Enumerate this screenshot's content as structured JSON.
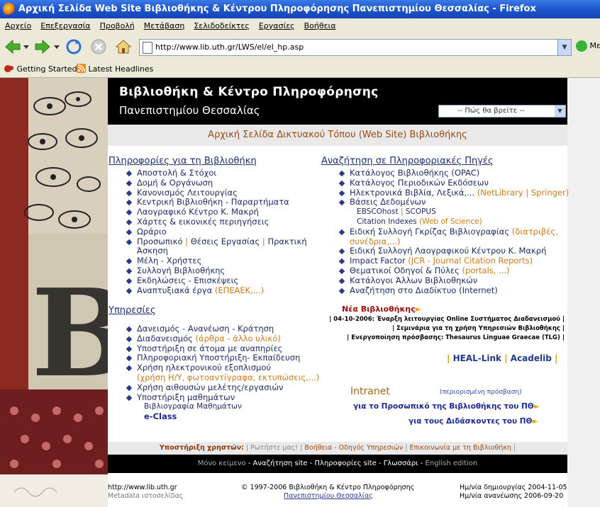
{
  "window": {
    "title": "Αρχική Σελίδα Web Site Βιβλιοθήκης & Κέντρου Πληροφόρησης Πανεπιστημίου Θεσσαλίας - Firefox"
  },
  "menu": [
    "Αρχείο",
    "Επεξεργασία",
    "Προβολή",
    "Μετάβαση",
    "Σελιδοδείκτες",
    "Εργασίες",
    "Βοήθεια"
  ],
  "address": {
    "url": "http://www.lib.uth.gr/LWS/el/el_hp.asp",
    "go_label": "Με"
  },
  "bookmarks": {
    "getting_started": "Getting Started",
    "latest_headlines": "Latest Headlines"
  },
  "header": {
    "title": "Βιβλιοθήκη & Κέντρο Πληροφόρησης",
    "subtitle": "Πανεπιστημίου Θεσσαλίας",
    "select_placeholder": "-- Πώς θα βρείτε --",
    "page_subtitle": "Αρχική Σελίδα Δικτυακού Τόπου (Web Site) Βιβλιοθήκης"
  },
  "left": {
    "info_heading": "Πληροφορίες για τη Βιβλιοθήκη",
    "info_items": [
      "Αποστολή & Στόχοι",
      "Δομή & Οργάνωση",
      "Κανονισμός Λειτουργίας",
      "Κεντρική Βιβλιοθήκη - Παραρτήματα",
      "Λαογραφικό Κέντρο Κ. Μακρή",
      "Χάρτες & εικονικές περιηγήσεις",
      "Ωράριο"
    ],
    "staff": {
      "a": "Προσωπικό",
      "sep1": "|",
      "b": "Θέσεις Εργασίας",
      "sep2": "|",
      "c": "Πρακτική",
      "d": "Άσκηση"
    },
    "info_items2": [
      "Μέλη - Χρήστες",
      "Συλλογή Βιβλιοθήκης",
      "Εκδηλώσεις - Επισκέψεις"
    ],
    "dev": {
      "a": "Αναπτυξιακά έργα",
      "b": "(ΕΠΕΑΕΚ,...)"
    },
    "services_heading": "Υπηρεσίες",
    "services": [
      "Δανεισμός - Ανανέωση - Κράτηση"
    ],
    "ill": {
      "a": "Διαδανεισμός",
      "b": "(άρθρα - άλλο υλικό)"
    },
    "services2": [
      "Υποστήριξη σε άτομα με αναπηρίες",
      "Πληροφοριακή Υποστήριξη- Εκπαίδευση",
      "Χρήση ηλεκτρονικού εξοπλισμού"
    ],
    "equipment_note": "(χρήση Η/Υ, φωτοαντίγραφα, εκτυπώσεις,...)",
    "services3": [
      "Χρήση αιθουσών μελέτης/εργασιών",
      "Υποστήριξη μαθημάτων"
    ],
    "course_bib": "Βιβλιογραφία Μαθημάτων",
    "eclass": "e-Class"
  },
  "right": {
    "search_heading": "Αναζήτηση σε Πληροφοριακές Πηγές",
    "r1": "Κατάλογος Βιβλιοθήκης (OPAC)",
    "r2": "Κατάλογος Περιοδικών Εκδόσεων",
    "ebooks": {
      "a": "Ηλεκτρονικά Βιβλία, Λεξικά,...",
      "b": "(NetLibrary | Springer)"
    },
    "databases": "Βάσεις Δεδομένων",
    "ebsco": {
      "a": "EBSCOhost",
      "sep": "|",
      "b": "SCOPUS"
    },
    "citation": {
      "a": "Citation Indexes",
      "b": "(Web of Science)"
    },
    "grey": {
      "a": "Ειδική Συλλογή Γκρίζας Βιβλιογραφίας",
      "b": "(διατριβές,",
      "c": "συνέδρια,...)"
    },
    "folk": "Ειδική Συλλογή Λαογραφικού Κέντρου Κ. Μακρή",
    "impact": {
      "a": "Impact Factor",
      "b": "(JCR - Journal Citation Reports)"
    },
    "guides": {
      "a": "Θεματικοί Οδηγοί & Πύλες",
      "b": "(portals, ...)"
    },
    "others": "Κατάλογοι Άλλων Βιβλιοθηκών",
    "internet": "Αναζήτηση στο Διαδίκτυο (Internet)",
    "news_title": "Νέα Βιβλιοθήκης",
    "news": [
      "| 04-10-2006: Έναρξη λειτουργίας Online Συστήματος Διαδανεισμού |",
      "| Σεμινάρια για τη χρήση Υπηρεσιών Βιβλιοθήκης |",
      "| Ενεργοποίηση πρόσβασης: Thesaurus Linguae Graecae (TLG) |"
    ],
    "heal": "HEAL-Link",
    "acadelib": "Acadelib",
    "intranet": "Intranet",
    "restricted": "(περιορισμένη πρόσβαση)",
    "intranet_staff": "για το Προσωπικό της Βιβλιοθήκης του ΠΘ",
    "intranet_teachers": "για τους Διδάσκοντες του ΠΘ"
  },
  "support": {
    "label": "Υποστήριξη χρηστών:",
    "ask": "Ρωτήστε μας!",
    "help": "Βοήθεια - Οδηγός Υπηρεσιών",
    "contact": "Επικοινωνία με τη Βιβλιοθήκη"
  },
  "footer": {
    "text_only": "Μόνο κείμενο",
    "search_site": "Αναζήτηση site",
    "info_site": "Πληροφορίες site",
    "glossary": "Γλωσσάρι",
    "english": "English edition",
    "url": "http://www.lib.uth.gr",
    "metadata": "Metadata ιστοσελίδας",
    "copyright": "© 1997-2006 Βιβλιοθήκη & Κέντρο Πληροφόρησης",
    "univ": "Πανεπιστημίου Θεσσαλίας",
    "created": "Ημ/νία δημιουργίας 2004-11-05",
    "updated": "Ημ/νία ανανέωσης 2006-09-20"
  },
  "colors": {
    "accent_blue": "#1f2e6e",
    "accent_orange": "#cc7a1a",
    "news_red": "#a10e0e"
  }
}
